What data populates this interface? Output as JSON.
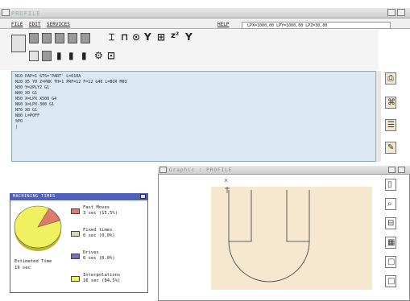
{
  "window": {
    "title": "PROFILE"
  },
  "menu": {
    "file": "FILE",
    "edit": "EDIT",
    "services": "SERVICES",
    "help": "HELP"
  },
  "coords": "LPX=1000,00 LPY=1000,00 LPZ=30,00",
  "editor": {
    "lines": [
      "N10 PAP=1 STS='PART' L=610A",
      "N20 X5 Y0 Z=PRK TH=1 PRF=12 F=12 G40 L=BCR M03",
      "N30 Y=2PLY2 G1",
      "N40 X0 G1",
      "N50 X=LPX X500 G4",
      "N60 X=LPX-300 G1",
      "N70 X0 G1",
      "N80 L=POFF",
      "%PO",
      "|"
    ]
  },
  "graphic_window": {
    "title": "Graphic : PROFILE",
    "axis_label": "X"
  },
  "machining_times": {
    "title": "MACHINING TIMES",
    "estimated_label": "Estimated Time",
    "estimated_value": "19 sec",
    "items": [
      {
        "label": "Fast Moves",
        "value": "3 sec (15,5%)",
        "color": "#e07a6a"
      },
      {
        "label": "Fixed times",
        "value": "0 sec (0,0%)",
        "color": "#d8d8b8"
      },
      {
        "label": "Drives",
        "value": "0 sec (0,0%)",
        "color": "#7070c8"
      },
      {
        "label": "Interpolations",
        "value": "16 sec (84,5%)",
        "color": "#f0f060"
      }
    ]
  },
  "colors": {
    "editor_bg": "#dbe8f3",
    "canvas_bg": "#f6e8cf",
    "panel_title": "#5060b8",
    "pie_main": "#f0f060",
    "pie_slice": "#e07a6a"
  }
}
